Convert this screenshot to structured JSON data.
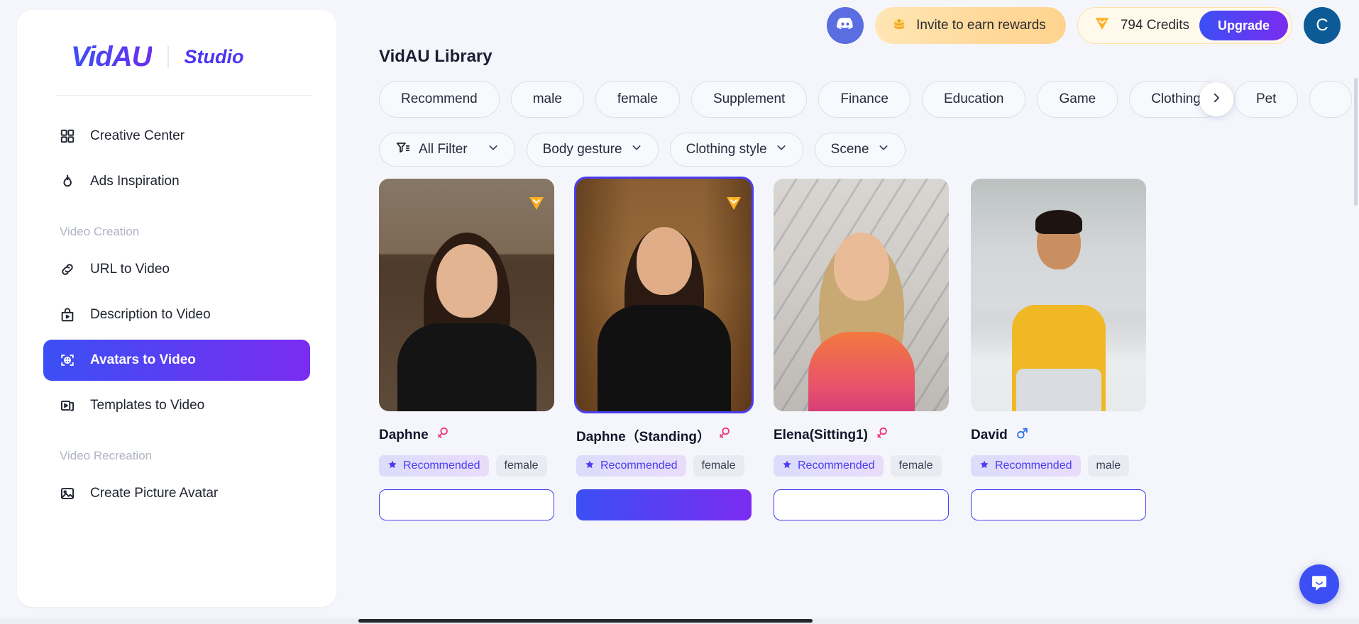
{
  "brand": {
    "name": "VidAU",
    "sub": "Studio"
  },
  "sidebar": {
    "items": [
      {
        "label": "Creative Center",
        "icon": "grid-icon"
      },
      {
        "label": "Ads Inspiration",
        "icon": "flame-icon"
      }
    ],
    "groups": [
      {
        "title": "Video Creation",
        "items": [
          {
            "label": "URL to Video",
            "icon": "link-icon",
            "active": false
          },
          {
            "label": "Description to Video",
            "icon": "bag-play-icon",
            "active": false
          },
          {
            "label": "Avatars to Video",
            "icon": "avatar-target-icon",
            "active": true
          },
          {
            "label": "Templates to Video",
            "icon": "templates-icon",
            "active": false
          }
        ]
      },
      {
        "title": "Video Recreation",
        "items": [
          {
            "label": "Create Picture Avatar",
            "icon": "image-icon",
            "active": false
          }
        ]
      }
    ]
  },
  "topbar": {
    "discord_label": "discord-icon",
    "invite_label": "Invite to earn rewards",
    "invite_icon": "coins-icon",
    "credits_label": "794 Credits",
    "credits_icon": "gem-icon",
    "upgrade_label": "Upgrade",
    "avatar_initial": "C"
  },
  "main": {
    "library_title": "VidAU Library",
    "chips": [
      "Recommend",
      "male",
      "female",
      "Supplement",
      "Finance",
      "Education",
      "Game",
      "Clothing",
      "Pet"
    ],
    "chips_next_icon": "chevron-right-icon",
    "filters": [
      {
        "label": "All Filter",
        "icon": "filter-icon",
        "caret": "⌄"
      },
      {
        "label": "Body gesture",
        "icon": "",
        "caret": "⌄"
      },
      {
        "label": "Clothing style",
        "icon": "",
        "caret": "⌄"
      },
      {
        "label": "Scene",
        "icon": "",
        "caret": "⌄"
      }
    ],
    "cards": [
      {
        "name": "Daphne",
        "gender": "female",
        "gender_symbol": "♀",
        "tag_recommended": "Recommended",
        "tag_gender": "female",
        "has_gem": true,
        "selected": false
      },
      {
        "name": "Daphne（Standing）",
        "gender": "female",
        "gender_symbol": "♀",
        "tag_recommended": "Recommended",
        "tag_gender": "female",
        "has_gem": true,
        "selected": true
      },
      {
        "name": "Elena(Sitting1)",
        "gender": "female",
        "gender_symbol": "♀",
        "tag_recommended": "Recommended",
        "tag_gender": "female",
        "has_gem": false,
        "selected": false
      },
      {
        "name": "David",
        "gender": "male",
        "gender_symbol": "♂",
        "tag_recommended": "Recommended",
        "tag_gender": "male",
        "has_gem": false,
        "selected": false
      }
    ]
  },
  "chat_fab_icon": "chat-bubble-icon",
  "colors": {
    "accent_start": "#3b4ff5",
    "accent_end": "#7b2cf0",
    "gold": "#ffb020",
    "female": "#f0337c",
    "male": "#2f6ff0",
    "avatar_bg": "#0c5a96"
  }
}
